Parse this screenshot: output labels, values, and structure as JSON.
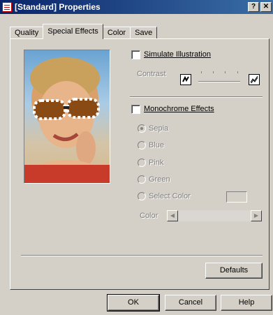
{
  "window": {
    "title": "[Standard] Properties",
    "help_button": "?",
    "close_button": "✕"
  },
  "tabs": [
    {
      "label": "Quality",
      "active": false
    },
    {
      "label": "Special Effects",
      "active": true
    },
    {
      "label": "Color",
      "active": false
    },
    {
      "label": "Save",
      "active": false
    }
  ],
  "simulate_illustration": {
    "label": "Simulate Illustration",
    "checked": false,
    "contrast_label": "Contrast"
  },
  "monochrome": {
    "label": "Monochrome Effects",
    "checked": false,
    "options": [
      {
        "label": "Sepia",
        "selected": true
      },
      {
        "label": "Blue",
        "selected": false
      },
      {
        "label": "Pink",
        "selected": false
      },
      {
        "label": "Green",
        "selected": false
      },
      {
        "label": "Select Color",
        "selected": false
      }
    ],
    "color_label": "Color"
  },
  "buttons": {
    "defaults": "Defaults",
    "ok": "OK",
    "cancel": "Cancel",
    "help": "Help"
  }
}
